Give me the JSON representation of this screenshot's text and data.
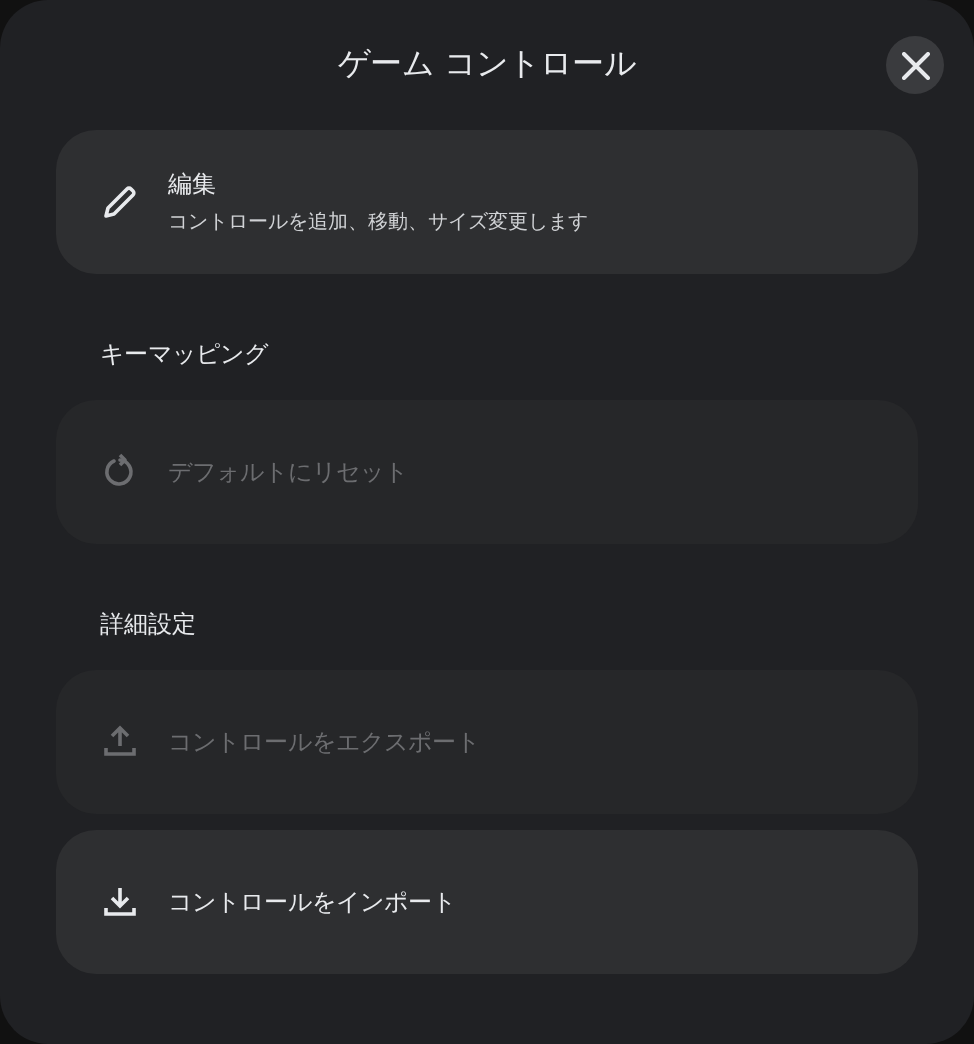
{
  "dialog": {
    "title": "ゲーム コントロール"
  },
  "sections": [
    {
      "items": [
        {
          "kind": "edit",
          "label": "編集",
          "subtitle": "コントロールを追加、移動、サイズ変更します",
          "disabled": false
        }
      ]
    },
    {
      "heading": "キーマッピング",
      "items": [
        {
          "kind": "reset",
          "label": "デフォルトにリセット",
          "disabled": true
        }
      ]
    },
    {
      "heading": "詳細設定",
      "items": [
        {
          "kind": "export",
          "label": "コントロールをエクスポート",
          "disabled": true
        },
        {
          "kind": "import",
          "label": "コントロールをインポート",
          "disabled": false
        }
      ]
    }
  ]
}
